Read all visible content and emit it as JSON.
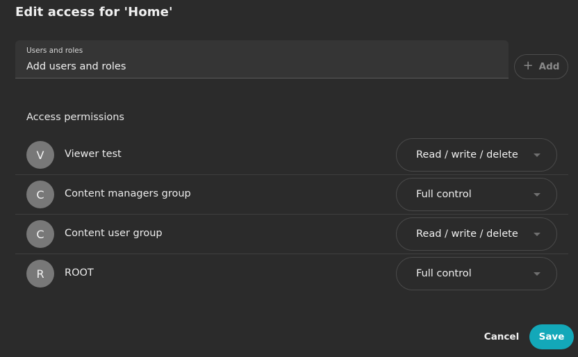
{
  "dialog": {
    "title": "Edit access for 'Home'"
  },
  "users_field": {
    "label": "Users and roles",
    "placeholder": "Add users and roles",
    "value": ""
  },
  "add_button": {
    "icon": "plus-icon",
    "label": "Add"
  },
  "permissions": {
    "title": "Access permissions",
    "rows": [
      {
        "initial": "V",
        "name": "Viewer test",
        "access": "Read / write / delete"
      },
      {
        "initial": "C",
        "name": "Content managers group",
        "access": "Full control"
      },
      {
        "initial": "C",
        "name": "Content user group",
        "access": "Read / write / delete"
      },
      {
        "initial": "R",
        "name": "ROOT",
        "access": "Full control"
      }
    ]
  },
  "footer": {
    "cancel_label": "Cancel",
    "save_label": "Save"
  },
  "colors": {
    "background": "#2b2b2b",
    "accent": "#13a8b9",
    "avatar": "#787878"
  }
}
